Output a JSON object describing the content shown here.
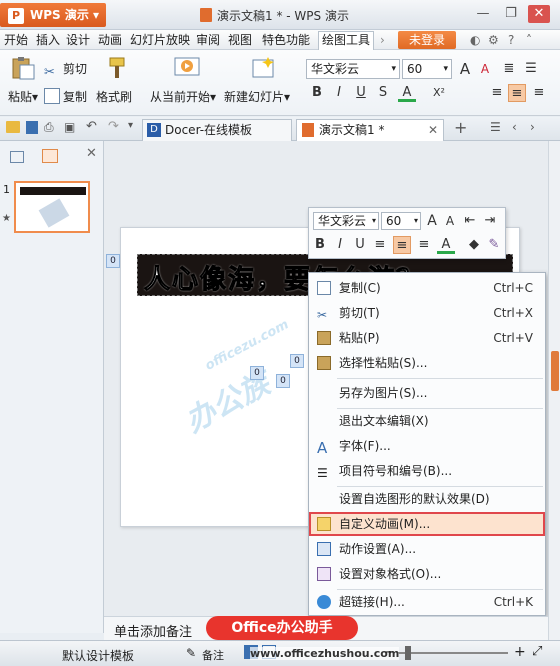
{
  "titlebar": {
    "app_button": "WPS 演示",
    "doc_title": "演示文稿1 * - WPS 演示"
  },
  "menubar": {
    "items": [
      "开始",
      "插入",
      "设计",
      "动画",
      "幻灯片放映",
      "审阅",
      "视图",
      "特色功能",
      "绘图工具"
    ],
    "active": "绘图工具",
    "login": "未登录"
  },
  "ribbon": {
    "paste": "粘贴",
    "cut": "剪切",
    "copy": "复制",
    "format_painter": "格式刷",
    "from_current": "从当前开始",
    "new_slide": "新建幻灯片",
    "font_name": "华文彩云",
    "font_size": "60"
  },
  "tabs": {
    "docer": "Docer-在线模板",
    "doc": "演示文稿1 *",
    "add": "+"
  },
  "slide": {
    "title_text": "人心像海，要怎么游？",
    "thumb_number": "1"
  },
  "handles": [
    "0",
    "0",
    "0",
    "0"
  ],
  "minitoolbar": {
    "font": "华文彩云",
    "size": "60"
  },
  "context_menu": {
    "items": [
      {
        "label": "复制(C)",
        "shortcut": "Ctrl+C",
        "icon": "copy-icon"
      },
      {
        "label": "剪切(T)",
        "shortcut": "Ctrl+X",
        "icon": "scissors-icon"
      },
      {
        "label": "粘贴(P)",
        "shortcut": "Ctrl+V",
        "icon": "paste-icon"
      },
      {
        "label": "选择性粘贴(S)...",
        "shortcut": "",
        "icon": "paste-special-icon"
      },
      {
        "label": "另存为图片(S)...",
        "shortcut": "",
        "icon": ""
      },
      {
        "label": "退出文本编辑(X)",
        "shortcut": "",
        "icon": ""
      },
      {
        "label": "字体(F)...",
        "shortcut": "",
        "icon": "font-icon"
      },
      {
        "label": "项目符号和编号(B)...",
        "shortcut": "",
        "icon": "list-icon"
      },
      {
        "label": "设置自选图形的默认效果(D)",
        "shortcut": "",
        "icon": ""
      },
      {
        "label": "自定义动画(M)...",
        "shortcut": "",
        "icon": "animation-icon"
      },
      {
        "label": "动作设置(A)...",
        "shortcut": "",
        "icon": "action-icon"
      },
      {
        "label": "设置对象格式(O)...",
        "shortcut": "",
        "icon": "format-object-icon"
      },
      {
        "label": "超链接(H)...",
        "shortcut": "Ctrl+K",
        "icon": "hyperlink-icon"
      }
    ]
  },
  "notes": {
    "placeholder": "单击添加备注"
  },
  "badge": {
    "text": "Office办公助手"
  },
  "statusbar": {
    "template": "默认设计模板",
    "notes": "备注",
    "url": "www.officezhushou.com"
  },
  "watermark": {
    "text": "officezu.com",
    "brand": "办公族"
  },
  "colors": {
    "accent": "#e06a24",
    "highlight_border": "#e0474c",
    "highlight_fill": "#fde3cf"
  }
}
